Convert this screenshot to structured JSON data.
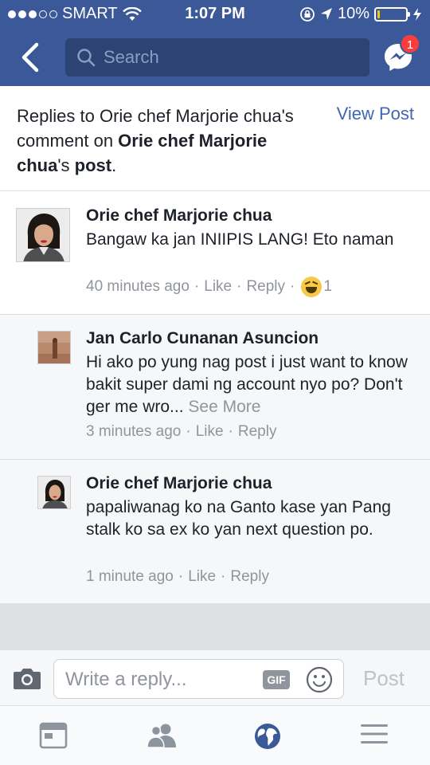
{
  "status": {
    "carrier": "SMART",
    "time": "1:07 PM",
    "battery_text": "10%",
    "battery_level": 0.1
  },
  "nav": {
    "search_placeholder": "Search",
    "messenger_badge": "1"
  },
  "header": {
    "prefix": "Replies to ",
    "author1": "Orie chef Marjorie chua",
    "middle": "'s comment on ",
    "author2": "Orie chef Marjorie chua",
    "suffix": "'s ",
    "post_word": "post",
    "end": ".",
    "view_post": "View Post"
  },
  "comments": [
    {
      "name": "Orie chef Marjorie chua",
      "text": "Bangaw ka jan INIIPIS LANG! Eto naman",
      "time": "40 minutes ago",
      "like": "Like",
      "reply": "Reply",
      "reaction_count": "1",
      "reaction_icon": "haha-icon"
    },
    {
      "name": "Jan Carlo Cunanan Asuncion",
      "text": "Hi ako po yung nag post i just want to know bakit super dami ng account nyo po? Don't ger me wro...",
      "see_more": "See More",
      "time": "3 minutes ago",
      "like": "Like",
      "reply": "Reply"
    },
    {
      "name": "Orie chef Marjorie chua",
      "text": "papaliwanag ko na Ganto kase yan Pang stalk ko sa ex ko yan next question po.",
      "time": "1 minute ago",
      "like": "Like",
      "reply": "Reply"
    }
  ],
  "reply_bar": {
    "placeholder": "Write a reply...",
    "gif_label": "GIF",
    "post_label": "Post"
  },
  "separator": "·",
  "colors": {
    "brand": "#3b5998",
    "link": "#4267b2",
    "muted": "#90949c",
    "badge": "#fa3e3e"
  }
}
